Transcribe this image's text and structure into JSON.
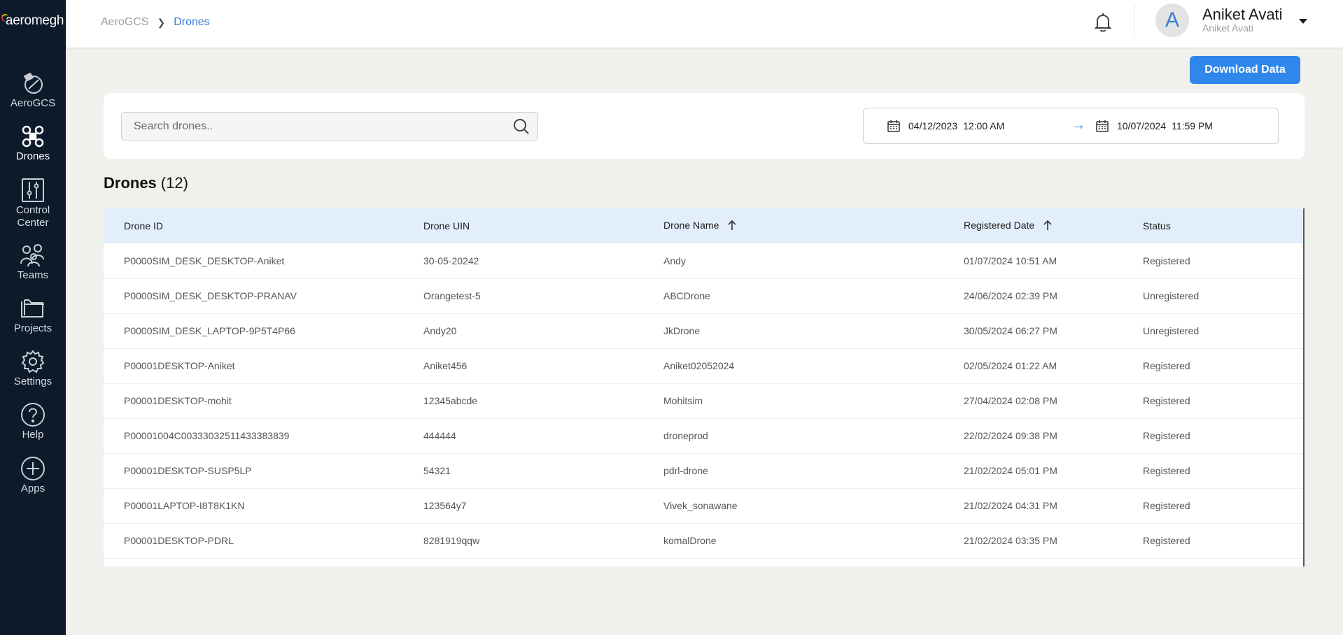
{
  "app": {
    "logo_text": "aeromegh"
  },
  "sidebar": {
    "items": [
      {
        "label": "AeroGCS",
        "icon": "aerogcs-icon",
        "active": false
      },
      {
        "label": "Drones",
        "icon": "drone-icon",
        "active": true
      },
      {
        "label": "Control Center",
        "icon": "control-center-icon",
        "active": false
      },
      {
        "label": "Teams",
        "icon": "teams-icon",
        "active": false
      },
      {
        "label": "Projects",
        "icon": "folder-icon",
        "active": false
      },
      {
        "label": "Settings",
        "icon": "gear-icon",
        "active": false
      },
      {
        "label": "Help",
        "icon": "help-icon",
        "active": false
      },
      {
        "label": "Apps",
        "icon": "plus-circle-icon",
        "active": false
      }
    ]
  },
  "header": {
    "breadcrumb_root": "AeroGCS",
    "breadcrumb_current": "Drones",
    "avatar_letter": "A",
    "user_name": "Aniket Avati",
    "user_sub": "Aniket Avati"
  },
  "actions": {
    "download_label": "Download Data"
  },
  "search": {
    "placeholder": "Search drones..",
    "value": ""
  },
  "date_range": {
    "from_date": "04/12/2023",
    "from_time": "12:00 AM",
    "to_date": "10/07/2024",
    "to_time": "11:59 PM",
    "arrow": "→"
  },
  "section": {
    "title": "Drones",
    "count": "(12)"
  },
  "table": {
    "columns": [
      "Drone ID",
      "Drone UIN",
      "Drone Name",
      "Registered Date",
      "Status"
    ],
    "rows": [
      [
        "P0000SIM_DESK_DESKTOP-Aniket",
        "30-05-20242",
        "Andy",
        "01/07/2024 10:51 AM",
        "Registered"
      ],
      [
        "P0000SIM_DESK_DESKTOP-PRANAV",
        "Orangetest-5",
        "ABCDrone",
        "24/06/2024 02:39 PM",
        "Unregistered"
      ],
      [
        "P0000SIM_DESK_LAPTOP-9P5T4P66",
        "Andy20",
        "JkDrone",
        "30/05/2024 06:27 PM",
        "Unregistered"
      ],
      [
        "P00001DESKTOP-Aniket",
        "Aniket456",
        "Aniket02052024",
        "02/05/2024 01:22 AM",
        "Registered"
      ],
      [
        "P00001DESKTOP-mohit",
        "12345abcde",
        "Mohitsim",
        "27/04/2024 02:08 PM",
        "Registered"
      ],
      [
        "P00001004C00333032511433383839",
        "444444",
        "droneprod",
        "22/02/2024 09:38 PM",
        "Registered"
      ],
      [
        "P00001DESKTOP-SUSP5LP",
        "54321",
        "pdrl-drone",
        "21/02/2024 05:01 PM",
        "Registered"
      ],
      [
        "P00001LAPTOP-I8T8K1KN",
        "123564y7",
        "Vivek_sonawane",
        "21/02/2024 04:31 PM",
        "Registered"
      ],
      [
        "P00001DESKTOP-PDRL",
        "8281919qqw",
        "komalDrone",
        "21/02/2024 03:35 PM",
        "Registered"
      ]
    ]
  },
  "colors": {
    "sidebar_bg": "#0c1a2a",
    "accent": "#2f86eb",
    "table_header_bg": "#e3eefc",
    "page_bg": "#f0f0ec"
  }
}
